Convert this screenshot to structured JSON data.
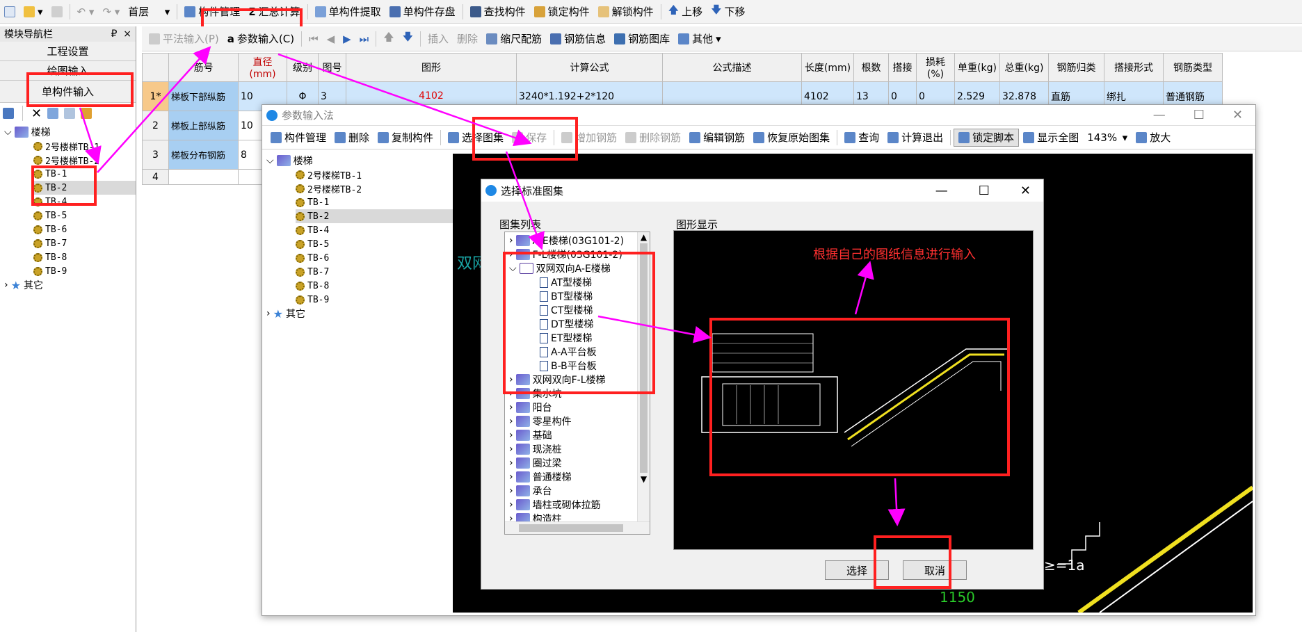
{
  "top_toolbar": {
    "floor": "首层",
    "items": [
      "构件管理",
      "汇总计算",
      "单构件提取",
      "单构件存盘",
      "查找构件",
      "锁定构件",
      "解锁构件",
      "上移",
      "下移"
    ]
  },
  "nav": {
    "title": "模块导航栏",
    "pin": "₽",
    "close": "×",
    "sections": [
      "工程设置",
      "绘图输入",
      "单构件输入"
    ],
    "tree_root": "楼梯",
    "tree_items": [
      "2号楼梯TB-1",
      "2号楼梯TB-2",
      "TB-1",
      "TB-2",
      "TB-4",
      "TB-5",
      "TB-6",
      "TB-7",
      "TB-8",
      "TB-9"
    ],
    "other": "其它"
  },
  "main_toolbar": {
    "items": [
      "平法输入(P)",
      "参数输入(C)",
      "插入",
      "删除",
      "缩尺配筋",
      "钢筋信息",
      "钢筋图库",
      "其他"
    ]
  },
  "grid": {
    "headers": [
      "筋号",
      "直径(mm)",
      "级别",
      "图号",
      "图形",
      "计算公式",
      "公式描述",
      "长度(mm)",
      "根数",
      "搭接",
      "损耗(%)",
      "单重(kg)",
      "总重(kg)",
      "钢筋归类",
      "搭接形式",
      "钢筋类型"
    ],
    "rows": [
      {
        "no": "1*",
        "name": "梯板下部纵筋",
        "dia": "10",
        "grade": "Φ",
        "fig": "3",
        "shape": "4102",
        "formula": "3240*1.192+2*120",
        "desc": "",
        "len": "4102",
        "count": "13",
        "lap": "0",
        "loss": "0",
        "unit": "2.529",
        "total": "32.878",
        "cat": "直筋",
        "lapform": "绑扎",
        "type": "普通钢筋"
      },
      {
        "no": "2",
        "name": "梯板上部纵筋",
        "dia": "10",
        "grade": "",
        "fig": "",
        "shape": "",
        "formula": "",
        "desc": "",
        "len": "",
        "count": "",
        "lap": "",
        "loss": "",
        "unit": "",
        "total": "",
        "cat": "",
        "lapform": "",
        "type": ""
      },
      {
        "no": "3",
        "name": "梯板分布钢筋",
        "dia": "8",
        "grade": "",
        "fig": "",
        "shape": "",
        "formula": "",
        "desc": "",
        "len": "",
        "count": "",
        "lap": "",
        "loss": "",
        "unit": "",
        "total": "",
        "cat": "",
        "lapform": "",
        "type": ""
      },
      {
        "no": "4",
        "name": "",
        "dia": "",
        "grade": "",
        "fig": "",
        "shape": "",
        "formula": "",
        "desc": "",
        "len": "",
        "count": "",
        "lap": "",
        "loss": "",
        "unit": "",
        "total": "",
        "cat": "",
        "lapform": "",
        "type": ""
      }
    ]
  },
  "param_dialog": {
    "title": "参数输入法",
    "toolbar": [
      "构件管理",
      "删除",
      "复制构件",
      "选择图集",
      "保存",
      "增加钢筋",
      "删除钢筋",
      "编辑钢筋",
      "恢复原始图集",
      "查询",
      "计算退出",
      "锁定脚本",
      "显示全图",
      "143%",
      "放大"
    ],
    "tree_root": "楼梯",
    "tree_items": [
      "2号楼梯TB-1",
      "2号楼梯TB-2",
      "TB-1",
      "TB-2",
      "TB-4",
      "TB-5",
      "TB-6",
      "TB-7",
      "TB-8",
      "TB-9"
    ],
    "other": "其它",
    "canvas_text": [
      "双网",
      "≥=1a",
      "1150"
    ]
  },
  "atlas_dialog": {
    "title": "选择标准图集",
    "list_label": "图集列表",
    "preview_label": "图形显示",
    "groups": [
      {
        "label": "A-E楼梯(03G101-2)",
        "open": false
      },
      {
        "label": "F-L楼梯(03G101-2)",
        "open": false
      },
      {
        "label": "双网双向A-E楼梯",
        "open": true,
        "children": [
          "AT型楼梯",
          "BT型楼梯",
          "CT型楼梯",
          "DT型楼梯",
          "ET型楼梯",
          "A-A平台板",
          "B-B平台板"
        ]
      },
      {
        "label": "双网双向F-L楼梯",
        "open": false
      },
      {
        "label": "集水坑",
        "open": false
      },
      {
        "label": "阳台",
        "open": false
      },
      {
        "label": "零星构件",
        "open": false
      },
      {
        "label": "基础",
        "open": false
      },
      {
        "label": "现浇桩",
        "open": false
      },
      {
        "label": "圈过梁",
        "open": false
      },
      {
        "label": "普通楼梯",
        "open": false
      },
      {
        "label": "承台",
        "open": false
      },
      {
        "label": "墙柱或砌体拉筋",
        "open": false
      },
      {
        "label": "构造柱",
        "open": false
      }
    ],
    "annotation": "根据自己的图纸信息进行输入",
    "select_button": "选择",
    "cancel_button": "取消"
  },
  "colors": {
    "highlight": "#ff2020",
    "arrow": "#ff00ff",
    "selected_row": "#cfe6fb",
    "name_cell": "#a8cff2"
  }
}
